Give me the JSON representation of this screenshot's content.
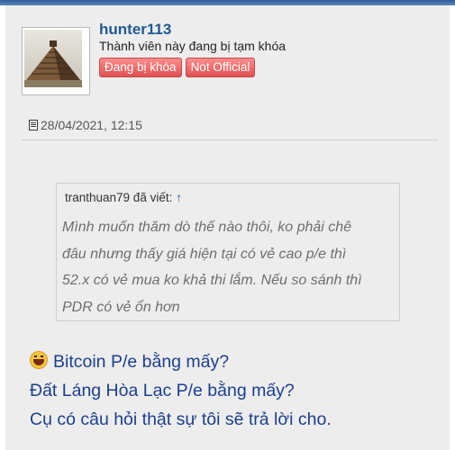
{
  "post": {
    "username": "hunter113",
    "user_status": "Thành viên này đang bị tạm khóa",
    "badges": [
      "Đang bị khóa",
      "Not Official"
    ],
    "date": "28/04/2021, 12:15"
  },
  "quote": {
    "author_line": "tranthuan79 đã viết:",
    "arrow": "↑",
    "lines": [
      "Mình muốn thăm dò thế nào thôi, ko phải chê",
      "đâu nhưng thấy giá hiện tại có vẻ cao p/e thì",
      "52.x có vẻ mua ko khả thi lắm. Nếu so sánh thì",
      "PDR có vẻ ổn hơn"
    ]
  },
  "reply": {
    "lines": [
      "Bitcoin P/e bằng mấy?",
      "Đất Láng Hòa Lạc P/e bằng mấy?",
      "Cụ có câu hỏi thật sự tôi sẽ trả lời cho."
    ]
  },
  "icons": {
    "date_icon": "document-icon",
    "reply_emoji": "laughing-emoji-icon"
  },
  "colors": {
    "username": "#1e5a93",
    "badge": "#e05050",
    "reply_text": "#1b3f8f",
    "quote_text": "#6e6e6e"
  }
}
